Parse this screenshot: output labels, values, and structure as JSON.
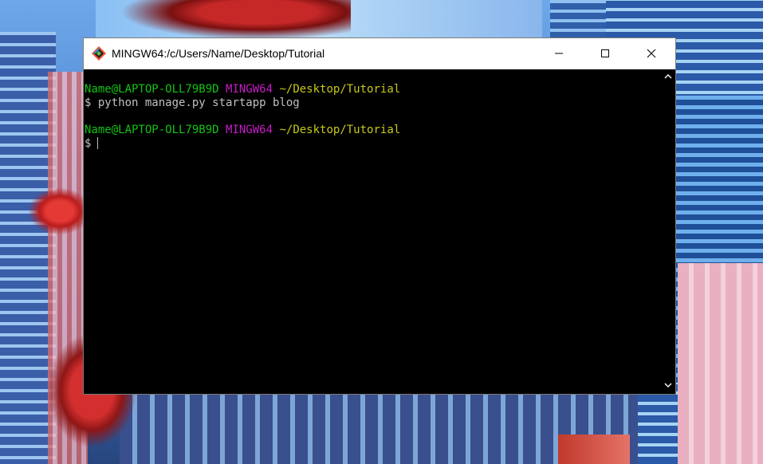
{
  "window": {
    "title": "MINGW64:/c/Users/Name/Desktop/Tutorial",
    "icon": "git-bash-icon"
  },
  "controls": {
    "minimize": "minimize-icon",
    "maximize": "maximize-icon",
    "close": "close-icon"
  },
  "terminal": {
    "colors": {
      "user_host": "#13c313",
      "system": "#c81bc8",
      "path": "#c8c818",
      "text": "#c0c0c0",
      "background": "#000000"
    },
    "blocks": [
      {
        "user_host": "Name@LAPTOP-OLL79B9D",
        "system": "MINGW64",
        "path": "~/Desktop/Tutorial",
        "command": "$ python manage.py startapp blog"
      },
      {
        "user_host": "Name@LAPTOP-OLL79B9D",
        "system": "MINGW64",
        "path": "~/Desktop/Tutorial",
        "command": "$"
      }
    ]
  },
  "scrollbar": {
    "up": "chevron-up-icon",
    "down": "chevron-down-icon"
  }
}
